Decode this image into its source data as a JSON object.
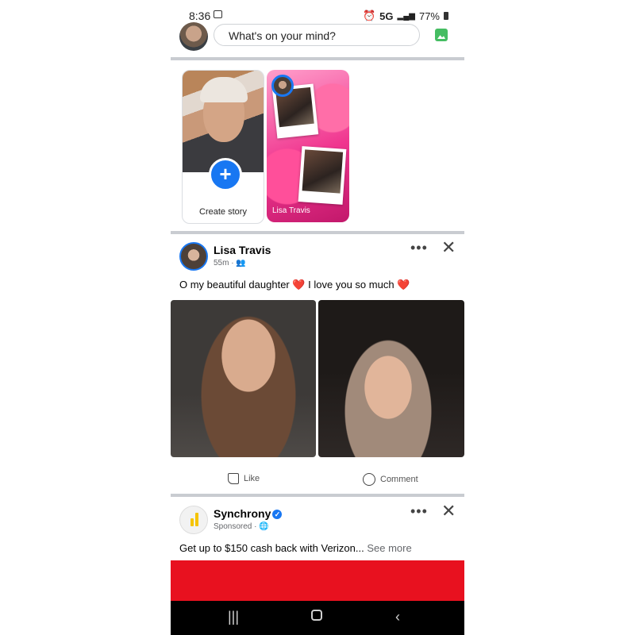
{
  "status_bar": {
    "time": "8:36",
    "network": "5G",
    "battery": "77%"
  },
  "composer": {
    "placeholder": "What's on your mind?"
  },
  "stories": {
    "create_label": "Create story",
    "items": [
      {
        "name": "Lisa Travis"
      }
    ]
  },
  "post1": {
    "author": "Lisa Travis",
    "time": "55m",
    "text_part1": "O my beautiful daughter ",
    "text_part2": " I love you so much ",
    "heart": "❤️",
    "actions": {
      "like": "Like",
      "comment": "Comment"
    }
  },
  "post2": {
    "author": "Synchrony",
    "meta": "Sponsored",
    "text": "Get up to $150 cash back with Verizon...",
    "see_more": "See more",
    "banner_color": "#e8111f"
  },
  "colors": {
    "accent": "#1877f2",
    "divider": "#c9ccd1"
  }
}
